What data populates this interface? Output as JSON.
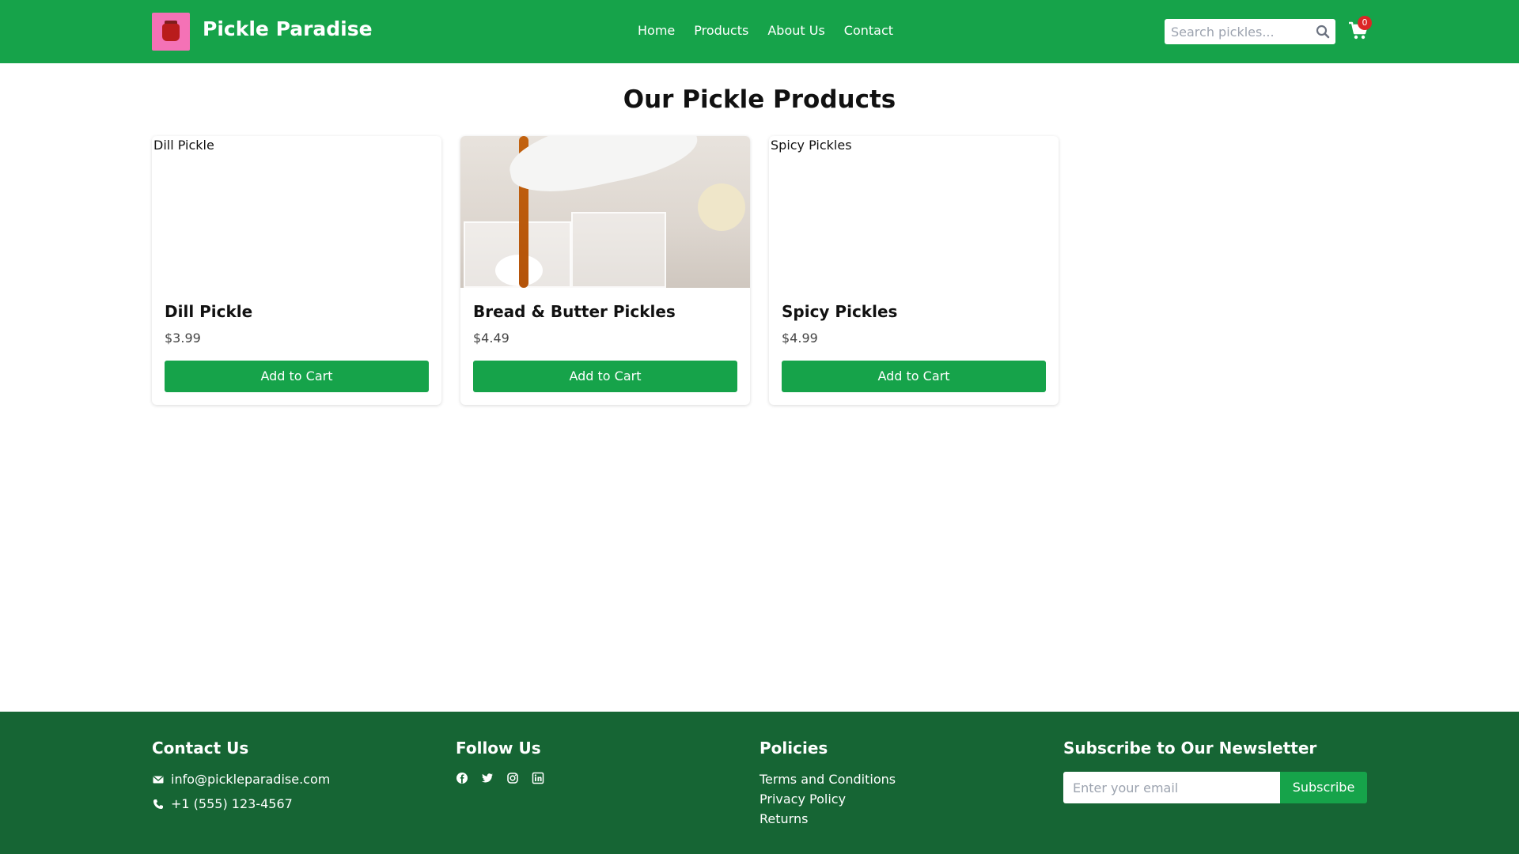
{
  "header": {
    "brand": "Pickle Paradise",
    "nav": [
      "Home",
      "Products",
      "About Us",
      "Contact"
    ],
    "search_placeholder": "Search pickles...",
    "cart_count": "0"
  },
  "main": {
    "title": "Our Pickle Products",
    "products": [
      {
        "name": "Dill Pickle",
        "price": "$3.99",
        "image_alt": "Dill Pickle",
        "button": "Add to Cart"
      },
      {
        "name": "Bread & Butter Pickles",
        "price": "$4.49",
        "image_alt": "",
        "button": "Add to Cart"
      },
      {
        "name": "Spicy Pickles",
        "price": "$4.99",
        "image_alt": "Spicy Pickles",
        "button": "Add to Cart"
      }
    ]
  },
  "footer": {
    "contact": {
      "title": "Contact Us",
      "email": "info@pickleparadise.com",
      "phone": "+1 (555) 123-4567"
    },
    "follow": {
      "title": "Follow Us",
      "icons": [
        "facebook-icon",
        "twitter-icon",
        "instagram-icon",
        "linkedin-icon"
      ]
    },
    "policies": {
      "title": "Policies",
      "links": [
        "Terms and Conditions",
        "Privacy Policy",
        "Returns"
      ]
    },
    "newsletter": {
      "title": "Subscribe to Our Newsletter",
      "placeholder": "Enter your email",
      "button": "Subscribe"
    }
  },
  "colors": {
    "primary": "#16a34a",
    "footer": "#166534",
    "badge": "#dc2626"
  }
}
